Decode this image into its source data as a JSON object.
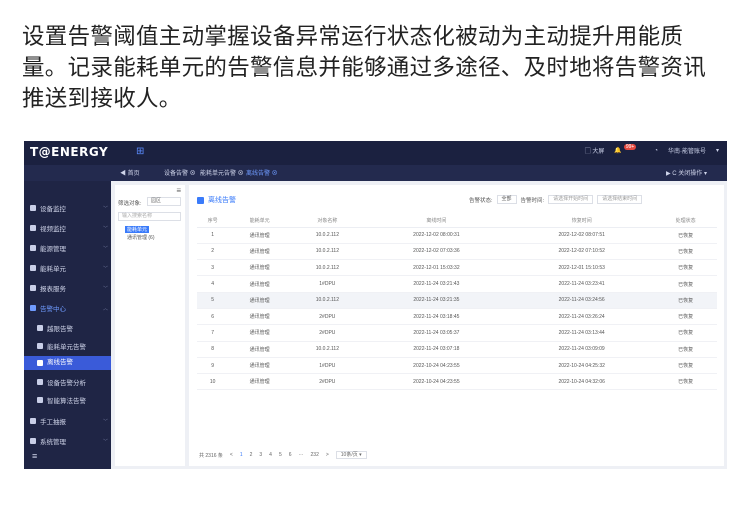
{
  "caption": "设置告警阈值主动掌握设备异常运行状态化被动为主动提升用能质量。记录能耗单元的告警信息并能够通过多途径、及时地将告警资讯推送到接收人。",
  "app": {
    "logo": "T@ENERGY",
    "topbar": {
      "screen": "大屏",
      "badge": "99+",
      "user": "华南·能管账号"
    },
    "tabs": [
      {
        "label": "◀ 首页"
      },
      {
        "label": "设备告警 ⊗"
      },
      {
        "label": "能耗单元告警 ⊗"
      },
      {
        "label": "离线告警 ⊗"
      }
    ],
    "close_ops": "▶  C  关闭操作 ▾",
    "sidebar": {
      "items": [
        "设备监控",
        "视频监控",
        "能源管理",
        "能耗单元",
        "报表服务",
        "告警中心"
      ],
      "sub": [
        "越限告警",
        "能耗单元告警",
        "离线告警",
        "设备告警分析",
        "智能算法告警"
      ],
      "bottom": [
        "手工抽报",
        "系统管理"
      ]
    },
    "tree": {
      "label": "筛选对象:",
      "select": "园区",
      "search_placeholder": "输入搜索名称",
      "node_root": "能耗单元",
      "node_child": "通讯管理 (6)"
    },
    "main": {
      "title": "离线告警",
      "filter_status_label": "告警状态:",
      "filter_status_value": "全部",
      "filter_time_label": "告警时间:",
      "filter_start": "请选择开始时间",
      "filter_end": "请选择结束时间",
      "columns": [
        "序号",
        "能耗单元",
        "对象名称",
        "离线时间",
        "恢复时间",
        "处理状态"
      ],
      "rows": [
        [
          "1",
          "通讯管理",
          "10.0.2.112",
          "2022-12-02 08:00:31",
          "2022-12-02 08:07:51",
          "已恢复"
        ],
        [
          "2",
          "通讯管理",
          "10.0.2.112",
          "2022-12-02 07:03:36",
          "2022-12-02 07:10:52",
          "已恢复"
        ],
        [
          "3",
          "通讯管理",
          "10.0.2.112",
          "2022-12-01 15:03:32",
          "2022-12-01 15:10:53",
          "已恢复"
        ],
        [
          "4",
          "通讯管理",
          "1#DPU",
          "2022-11-24 03:21:43",
          "2022-11-24 03:23:41",
          "已恢复"
        ],
        [
          "5",
          "通讯管理",
          "10.0.2.112",
          "2022-11-24 03:21:35",
          "2022-11-24 03:24:56",
          "已恢复"
        ],
        [
          "6",
          "通讯管理",
          "2#DPU",
          "2022-11-24 03:18:45",
          "2022-11-24 03:26:24",
          "已恢复"
        ],
        [
          "7",
          "通讯管理",
          "2#DPU",
          "2022-11-24 03:05:37",
          "2022-11-24 03:13:44",
          "已恢复"
        ],
        [
          "8",
          "通讯管理",
          "10.0.2.112",
          "2022-11-24 03:07:18",
          "2022-11-24 03:09:09",
          "已恢复"
        ],
        [
          "9",
          "通讯管理",
          "1#DPU",
          "2022-10-24 04:23:55",
          "2022-10-24 04:25:32",
          "已恢复"
        ],
        [
          "10",
          "通讯管理",
          "2#DPU",
          "2022-10-24 04:23:55",
          "2022-10-24 04:32:06",
          "已恢复"
        ]
      ],
      "pager": {
        "total": "共 2316 条",
        "prev": "<",
        "pages": [
          "1",
          "2",
          "3",
          "4",
          "5",
          "6",
          "···",
          "232"
        ],
        "next": ">",
        "page_size": "10条/页 ▾"
      }
    }
  },
  "colors": {
    "sidebar": "#1f2545",
    "topbar": "#1b2140",
    "accent": "#3a7bfa"
  }
}
